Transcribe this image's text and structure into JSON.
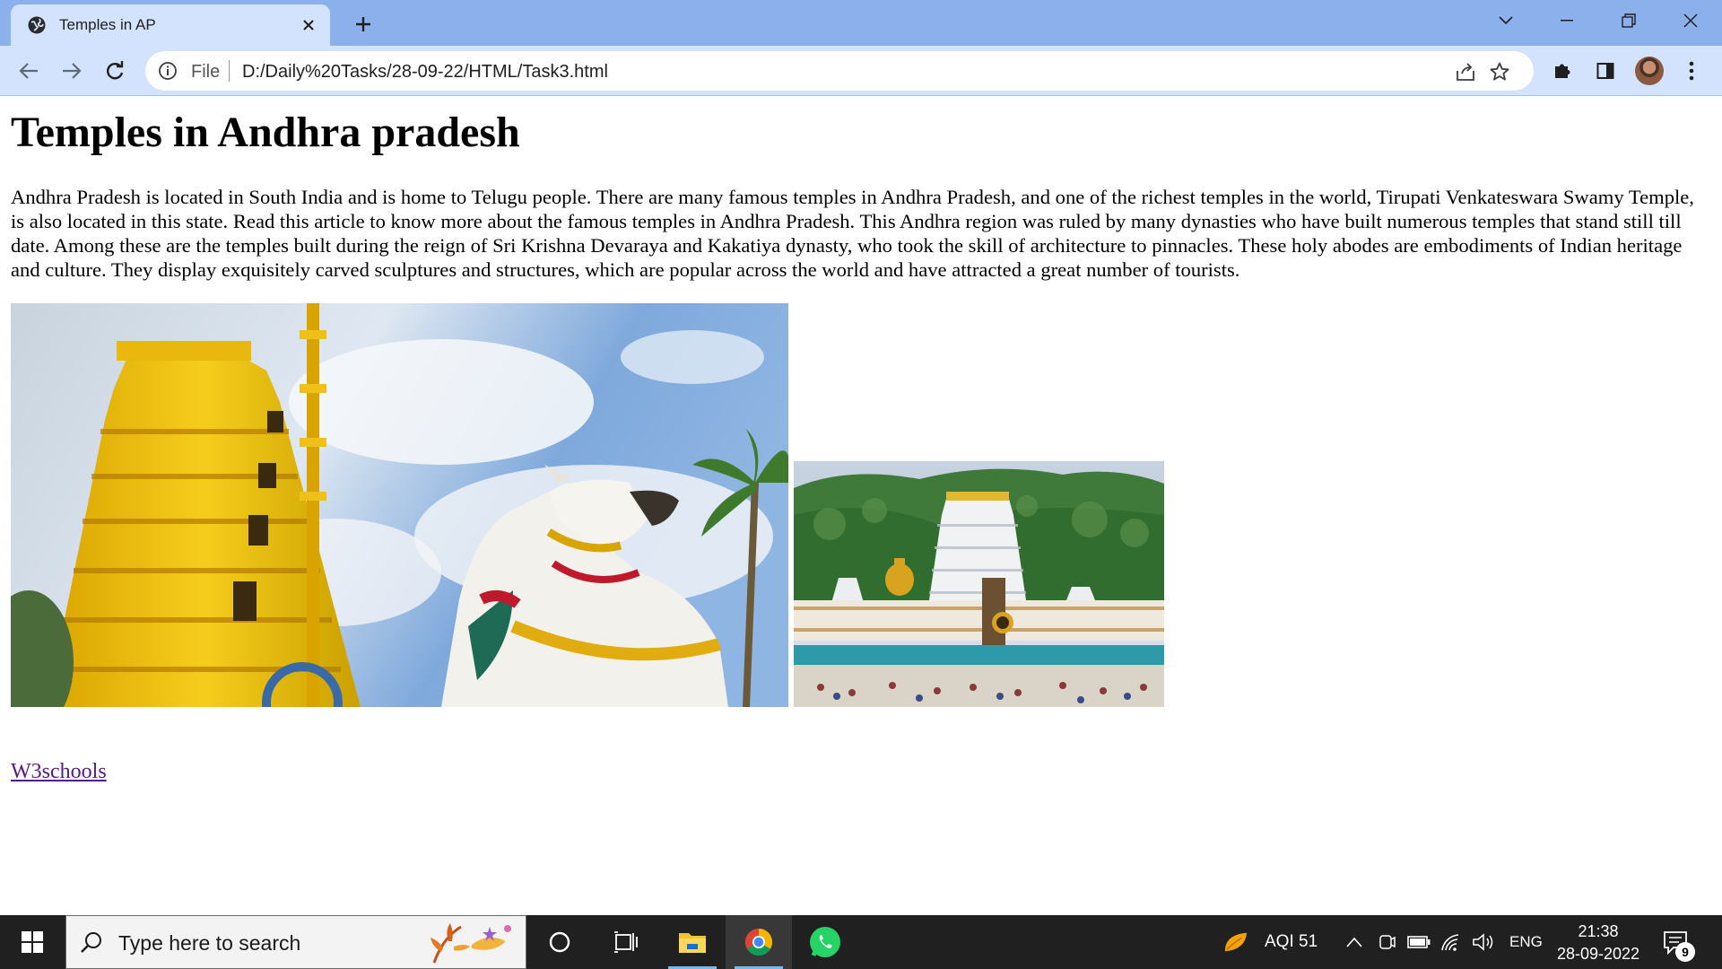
{
  "browser": {
    "tab_title": "Temples in AP",
    "url_scheme": "File",
    "url": "D:/Daily%20Tasks/28-09-22/HTML/Task3.html"
  },
  "page": {
    "title": "Temples in Andhra pradesh",
    "intro": "Andhra Pradesh is located in South India and is home to Telugu people. There are many famous temples in Andhra Pradesh, and one of the richest temples in the world, Tirupati Venkateswara Swamy Temple, is also located in this state. Read this article to know more about the famous temples in Andhra Pradesh. This Andhra region was ruled by many dynasties who have built numerous temples that stand still till date. Among these are the temples built during the reign of Sri Krishna Devaraya and Kakatiya dynasty, who took the skill of architecture to pinnacles. These holy abodes are embodiments of Indian heritage and culture. They display exquisitely carved sculptures and structures, which are popular across the world and have attracted a great number of tourists.",
    "link_text": "W3schools"
  },
  "taskbar": {
    "search_placeholder": "Type here to search",
    "aqi": "AQI 51",
    "language": "ENG",
    "time": "21:38",
    "date": "28-09-2022",
    "notification_count": "9"
  },
  "colors": {
    "tabstrip": "#8cb0ec",
    "toolbar": "#d3e3fd",
    "taskbar": "#202020",
    "link_visited": "#551a8b"
  }
}
